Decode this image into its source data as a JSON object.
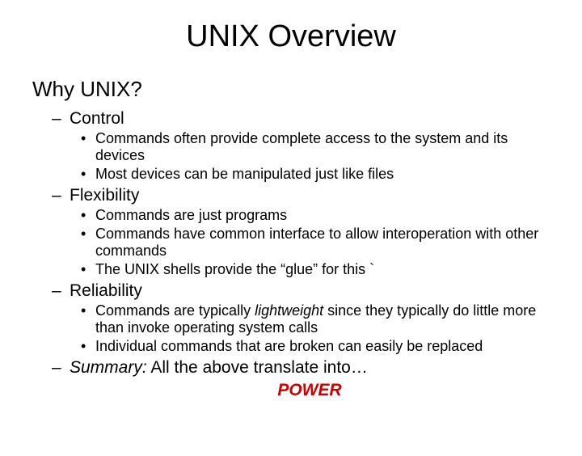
{
  "slide": {
    "title": "UNIX Overview",
    "subtitle": "Why UNIX?",
    "sections": [
      {
        "heading": "Control",
        "bullets": [
          "Commands often provide complete access to the system and its devices",
          "Most devices can be manipulated just like files"
        ]
      },
      {
        "heading": "Flexibility",
        "bullets": [
          "Commands are just programs",
          "Commands have common interface to allow interoperation with other commands",
          "The UNIX shells provide the “glue” for this `"
        ]
      },
      {
        "heading": "Reliability",
        "bullets_rich": [
          {
            "pre": "Commands are typically ",
            "italic": "lightweight",
            "post": " since they typically do little more than invoke operating system calls"
          },
          {
            "pre": "Individual commands that are broken can easily be replaced",
            "italic": "",
            "post": ""
          }
        ]
      }
    ],
    "summary": {
      "label": "Summary:",
      "text": "  All the above translate into…",
      "power": "POWER"
    }
  }
}
